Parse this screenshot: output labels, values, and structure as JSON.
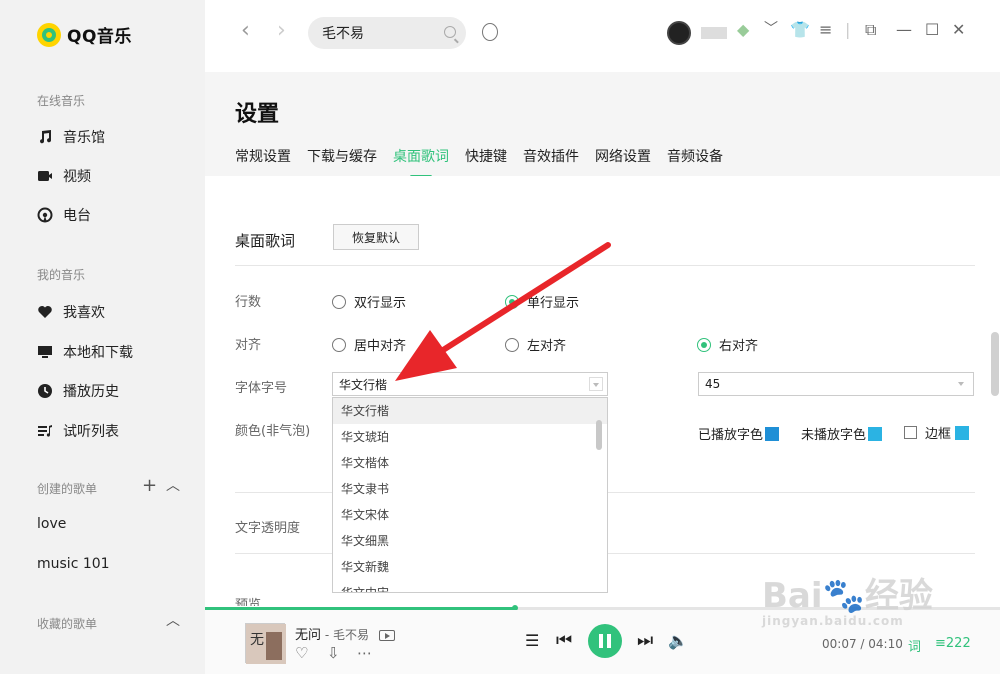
{
  "app": {
    "logo_text": "QQ音乐",
    "accent": "#31c27c"
  },
  "sidebar": {
    "online_section": "在线音乐",
    "online_items": [
      {
        "label": "音乐馆",
        "icon": "music-note-icon"
      },
      {
        "label": "视频",
        "icon": "video-icon"
      },
      {
        "label": "电台",
        "icon": "radio-icon"
      }
    ],
    "my_section": "我的音乐",
    "my_items": [
      {
        "label": "我喜欢",
        "icon": "heart-icon"
      },
      {
        "label": "本地和下载",
        "icon": "monitor-icon"
      },
      {
        "label": "播放历史",
        "icon": "clock-icon"
      },
      {
        "label": "试听列表",
        "icon": "playlist-icon"
      }
    ],
    "created_section": "创建的歌单",
    "created_items": [
      "love",
      "music  101"
    ],
    "collected_section": "收藏的歌单"
  },
  "topbar": {
    "search_value": "毛不易"
  },
  "settings": {
    "title": "设置",
    "tabs": [
      "常规设置",
      "下载与缓存",
      "桌面歌词",
      "快捷键",
      "音效插件",
      "网络设置",
      "音频设备"
    ],
    "active_tab": "桌面歌词",
    "section_title": "桌面歌词",
    "restore_button": "恢复默认",
    "rows_label": "行数",
    "rows_options": [
      "双行显示",
      "单行显示"
    ],
    "rows_selected": "单行显示",
    "align_label": "对齐",
    "align_options": [
      "居中对齐",
      "左对齐",
      "右对齐"
    ],
    "align_selected": "右对齐",
    "font_label": "字体字号",
    "font_value": "华文行楷",
    "font_size_value": "45",
    "font_options": [
      "华文行楷",
      "华文琥珀",
      "华文楷体",
      "华文隶书",
      "华文宋体",
      "华文细黑",
      "华文新魏",
      "华文中宋"
    ],
    "color_label": "颜色(非气泡)",
    "color_played": "已播放字色",
    "color_unplayed": "未播放字色",
    "color_border": "边框",
    "swatch_played": "#1f8fd6",
    "swatch_unplayed": "#2bb3e3",
    "swatch_border": "#2bb3e3",
    "opacity_label": "文字透明度",
    "partial_label": "预览"
  },
  "player": {
    "song": "无问",
    "separator": " - ",
    "artist": "毛不易",
    "time": "00:07 / 04:10",
    "progress": 0.39,
    "lyric_badge": "词",
    "playlist_count": "222"
  },
  "watermark": {
    "brand": "Bai",
    "brand2": "经验",
    "url": "jingyan.baidu.com"
  }
}
